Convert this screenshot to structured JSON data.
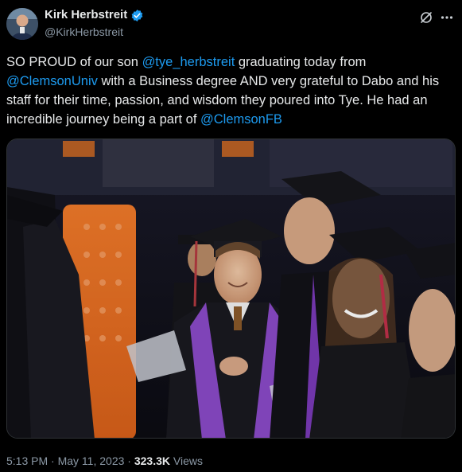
{
  "author": {
    "display_name": "Kirk Herbstreit",
    "handle": "@KirkHerbstreit",
    "verified": true
  },
  "icons": {
    "verified": "verified-badge-icon",
    "grok": "grok-icon",
    "more": "more-options-icon"
  },
  "tweet": {
    "segments": [
      {
        "text": "SO PROUD of our son ",
        "type": "text"
      },
      {
        "text": "@tye_herbstreit",
        "type": "mention"
      },
      {
        "text": " graduating today from ",
        "type": "text"
      },
      {
        "text": "@ClemsonUniv",
        "type": "mention"
      },
      {
        "text": " with a Business degree AND very grateful to Dabo and his staff for their time, passion, and wisdom they poured into Tye. He had an incredible journey being a part of ",
        "type": "text"
      },
      {
        "text": "@ClemsonFB",
        "type": "mention"
      }
    ]
  },
  "footer": {
    "time": "5:13 PM",
    "separator": "·",
    "date": "May 11, 2023",
    "separator2": "·",
    "views_count": "323.3K",
    "views_label": "Views"
  },
  "colors": {
    "background": "#000000",
    "text": "#e7e9ea",
    "secondary": "#8b98a5",
    "link": "#1d9bf0",
    "verified": "#1d9bf0"
  }
}
